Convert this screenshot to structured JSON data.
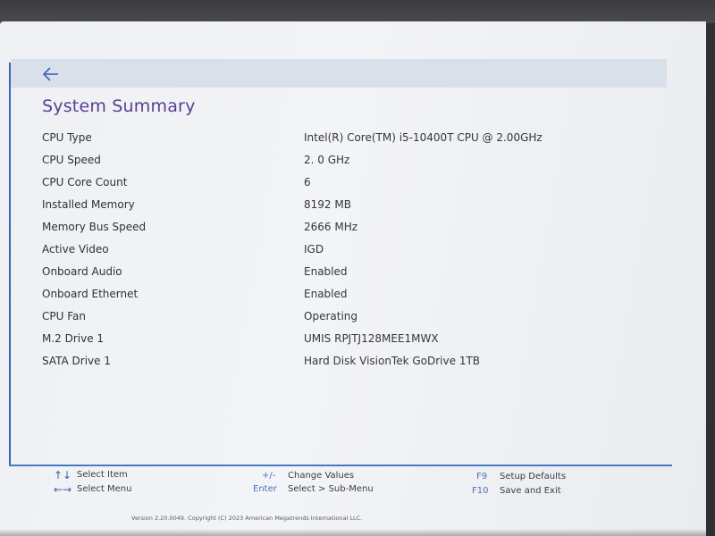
{
  "page": {
    "title": "System Summary",
    "back_icon": "arrow-left-icon"
  },
  "summary": [
    {
      "label": "CPU Type",
      "value": "Intel(R) Core(TM) i5-10400T CPU @ 2.00GHz"
    },
    {
      "label": "CPU Speed",
      "value": "2. 0 GHz"
    },
    {
      "label": "CPU Core Count",
      "value": "6"
    },
    {
      "label": "Installed Memory",
      "value": "8192 MB"
    },
    {
      "label": "Memory Bus Speed",
      "value": "2666 MHz"
    },
    {
      "label": "Active Video",
      "value": "IGD"
    },
    {
      "label": "Onboard Audio",
      "value": "Enabled"
    },
    {
      "label": "Onboard Ethernet",
      "value": "Enabled"
    },
    {
      "label": "CPU Fan",
      "value": "Operating"
    },
    {
      "label": "M.2 Drive 1",
      "value": "UMIS RPJTJ128MEE1MWX"
    },
    {
      "label": "SATA Drive 1",
      "value": "Hard Disk VisionTek GoDrive 1TB"
    }
  ],
  "footer": {
    "select_item_icon": "↑↓",
    "select_item": "Select Item",
    "select_menu_icon": "←→",
    "select_menu": "Select Menu",
    "change_values_key": "+/-",
    "change_values": "Change Values",
    "enter_key": "Enter",
    "select_submenu": "Select > Sub-Menu",
    "f9_key": "F9",
    "setup_defaults": "Setup Defaults",
    "f10_key": "F10",
    "save_exit": "Save and Exit",
    "copyright": "Version 2.20.0049. Copyright (C) 2023 American Megatrends International LLC."
  },
  "colors": {
    "accent": "#3d63b5",
    "title": "#5b3f8f",
    "header_bar": "#d9e0ea"
  }
}
